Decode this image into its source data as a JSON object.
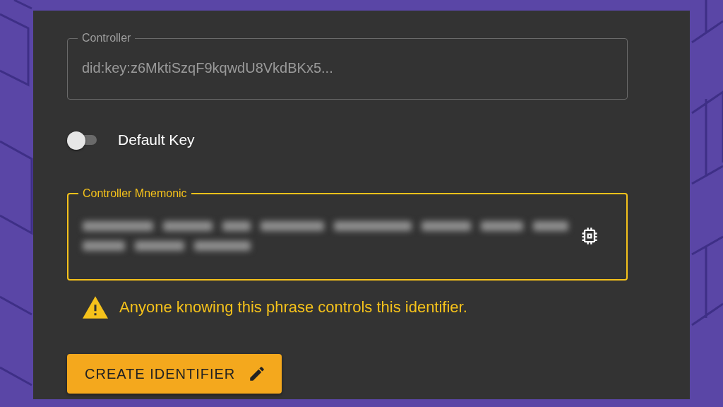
{
  "controller_field": {
    "label": "Controller",
    "value": "did:key:z6MktiSzqF9kqwdU8VkdBKx5...",
    "focused": false
  },
  "default_key_toggle": {
    "label": "Default Key",
    "on": false
  },
  "mnemonic_field": {
    "label": "Controller Mnemonic",
    "focused": true,
    "obscured": true
  },
  "warning": {
    "text": "Anyone knowing this phrase controls this identifier."
  },
  "create_button": {
    "label": "CREATE IDENTIFIER"
  }
}
